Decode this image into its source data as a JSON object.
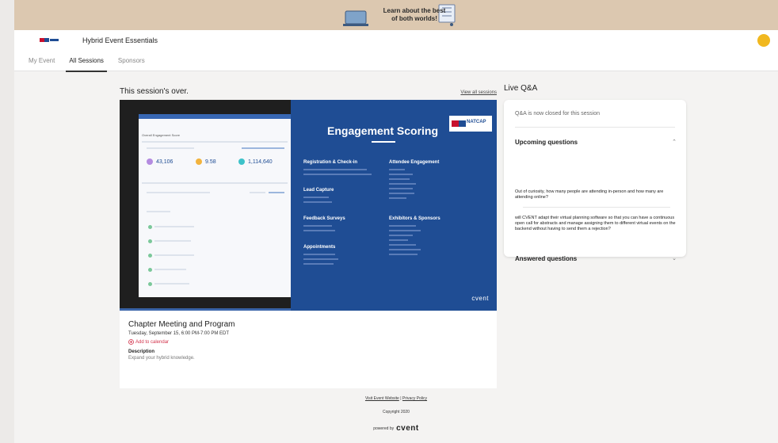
{
  "banner": {
    "line1": "Learn about the best",
    "line2": "of both worlds!"
  },
  "header": {
    "event_title": "Hybrid Event Essentials"
  },
  "nav": {
    "tabs": [
      {
        "label": "My Event"
      },
      {
        "label": "All Sessions"
      },
      {
        "label": "Sponsors"
      }
    ]
  },
  "session": {
    "status": "This session's over.",
    "view_all": "View all sessions",
    "name": "Chapter Meeting and Program",
    "time": "Tuesday, September 15, 6:00 PM-7:00 PM EDT",
    "add_to_calendar": "Add to calendar",
    "description_heading": "Description",
    "description": "Expand your hybrid knowledge."
  },
  "slide": {
    "title": "Engagement Scoring",
    "brand": "cvent",
    "logo": "NATCAP",
    "dashboard_heading": "Overall Engagement Score",
    "stats": [
      "43,106",
      "9.58",
      "1,114,640"
    ],
    "categories": [
      "Registration & Check-in",
      "Attendee Engagement",
      "Lead Capture",
      "Feedback Surveys",
      "Exhibitors & Sponsors",
      "Appointments"
    ]
  },
  "qa": {
    "title": "Live Q&A",
    "closed_text": "Q&A is now closed for this session",
    "upcoming_label": "Upcoming questions",
    "questions": [
      "Out of curiosity, how many people are attending in-person and how many are attending online?",
      "will CVENT adapt their virtual planning software so that you can have a continuous open call for abstracts and manage assigning them to different virtual events on the backend without having to send them a rejection?"
    ],
    "answered_label": "Answered questions"
  },
  "footer": {
    "visit_site": "Visit Event Website",
    "separator": "|",
    "privacy": "Privacy Policy",
    "copyright": "Copyright 2020",
    "powered_by": "powered by",
    "brand": "cvent"
  },
  "colors": {
    "accent_blue": "#1f4d94",
    "avatar": "#f1b81f",
    "calendar_link": "#d2334b",
    "banner": "#dcc8b0"
  }
}
